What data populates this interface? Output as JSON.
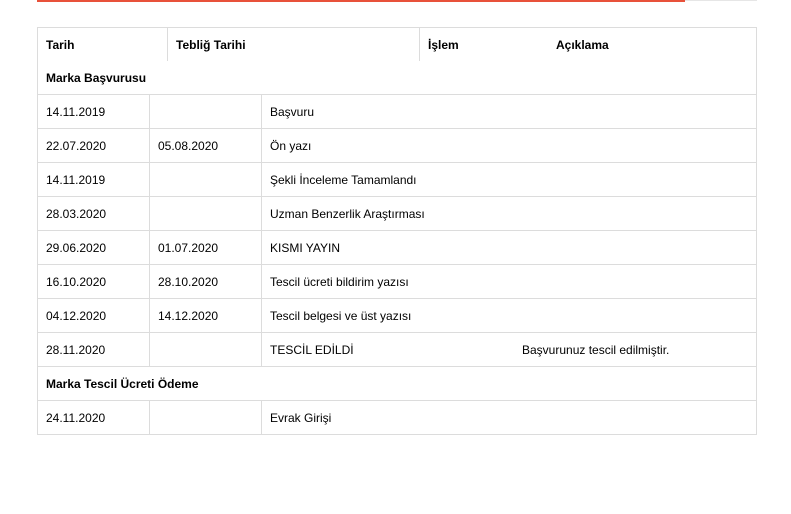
{
  "headers": {
    "date": "Tarih",
    "teblig": "Tebliğ Tarihi",
    "islem": "İşlem",
    "aciklama": "Açıklama"
  },
  "groups": [
    {
      "title": "Marka Başvurusu",
      "rows": [
        {
          "date": "14.11.2019",
          "teblig": "",
          "islem": "Başvuru",
          "aciklama": ""
        },
        {
          "date": "22.07.2020",
          "teblig": "05.08.2020",
          "islem": "Ön yazı",
          "aciklama": ""
        },
        {
          "date": "14.11.2019",
          "teblig": "",
          "islem": "Şekli İnceleme Tamamlandı",
          "aciklama": ""
        },
        {
          "date": "28.03.2020",
          "teblig": "",
          "islem": "Uzman Benzerlik Araştırması",
          "aciklama": ""
        },
        {
          "date": "29.06.2020",
          "teblig": "01.07.2020",
          "islem": "KISMI YAYIN",
          "aciklama": ""
        },
        {
          "date": "16.10.2020",
          "teblig": "28.10.2020",
          "islem": "Tescil ücreti bildirim yazısı",
          "aciklama": ""
        },
        {
          "date": "04.12.2020",
          "teblig": "14.12.2020",
          "islem": "Tescil belgesi ve üst yazısı",
          "aciklama": ""
        },
        {
          "date": "28.11.2020",
          "teblig": "",
          "islem": "TESCİL EDİLDİ",
          "aciklama": "Başvurunuz tescil edilmiştir."
        }
      ]
    },
    {
      "title": "Marka Tescil Ücreti Ödeme",
      "rows": [
        {
          "date": "24.11.2020",
          "teblig": "",
          "islem": "Evrak Girişi",
          "aciklama": ""
        }
      ]
    }
  ]
}
